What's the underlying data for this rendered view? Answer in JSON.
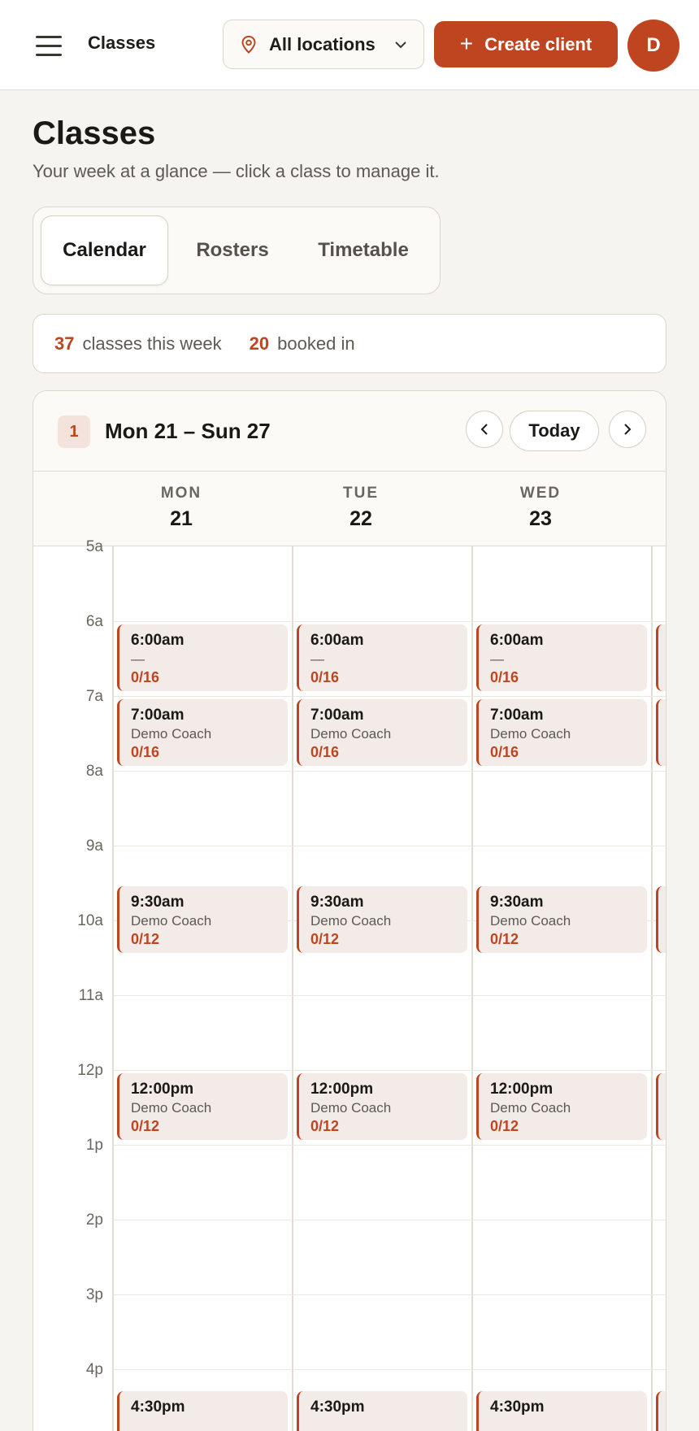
{
  "topbar": {
    "title": "Classes",
    "location_select": "All locations",
    "create_label": "Create client",
    "avatar_initial": "D"
  },
  "page": {
    "title": "Classes",
    "subtitle": "Your week at a glance — click a class to manage it."
  },
  "tabs": [
    {
      "label": "Calendar",
      "active": true
    },
    {
      "label": "Rosters",
      "active": false
    },
    {
      "label": "Timetable",
      "active": false
    }
  ],
  "stats": {
    "classes_count": "37",
    "classes_label": "classes this week",
    "booked_count": "20",
    "booked_label": "booked in"
  },
  "calendar": {
    "week_badge": "1",
    "week_range": "Mon 21 – Sun 27",
    "today_label": "Today",
    "days": [
      {
        "dow": "MON",
        "num": "21"
      },
      {
        "dow": "TUE",
        "num": "22"
      },
      {
        "dow": "WED",
        "num": "23"
      }
    ],
    "hours": [
      "5a",
      "6a",
      "7a",
      "8a",
      "9a",
      "10a",
      "11a",
      "12p",
      "1p",
      "2p",
      "3p",
      "4p"
    ],
    "class_slots": [
      {
        "time": "6:00am",
        "coach": "—",
        "capacity": "0/16"
      },
      {
        "time": "7:00am",
        "coach": "Demo Coach",
        "capacity": "0/16"
      },
      {
        "time": "9:30am",
        "coach": "Demo Coach",
        "capacity": "0/12"
      },
      {
        "time": "12:00pm",
        "coach": "Demo Coach",
        "capacity": "0/12"
      },
      {
        "time": "4:30pm",
        "coach": "",
        "capacity": ""
      }
    ]
  },
  "colors": {
    "accent": "#bf4520",
    "event_bg": "#f2ebe7",
    "page_bg": "#f6f4f0"
  }
}
